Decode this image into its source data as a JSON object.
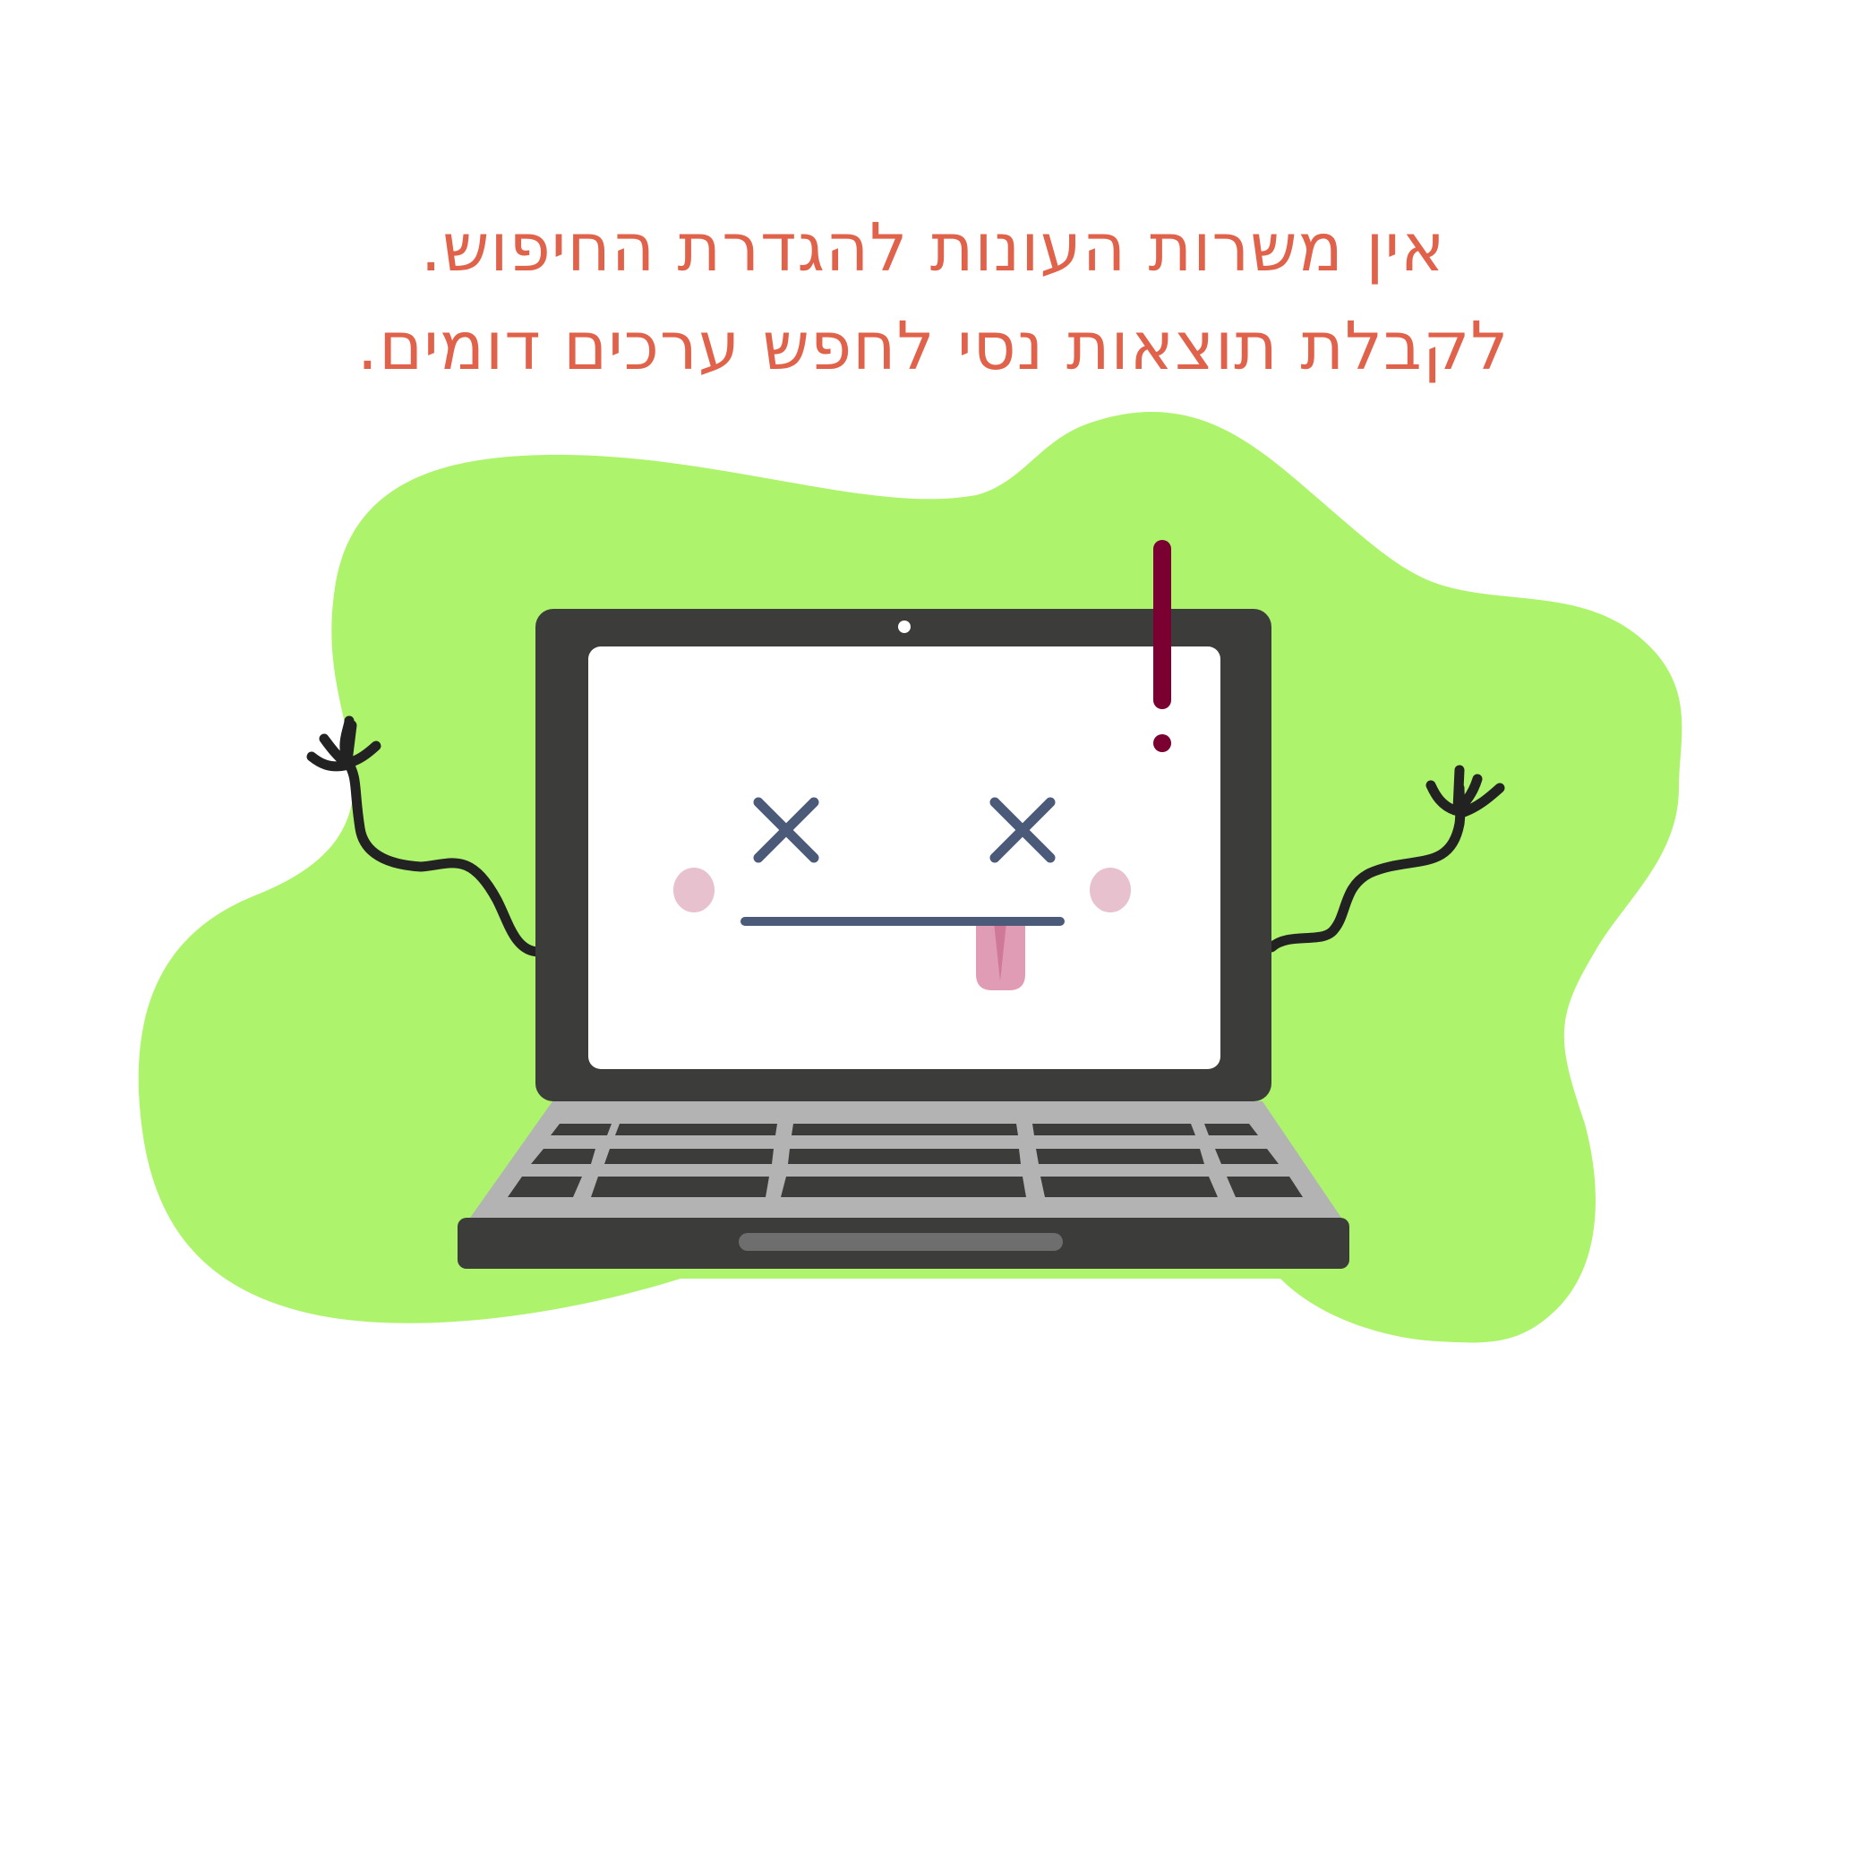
{
  "empty_state": {
    "line1": "אין משרות העונות להגדרת החיפוש.",
    "line2": "לקבלת תוצאות נסי לחפש ערכים דומים."
  },
  "illustration": {
    "subject": "sad-laptop",
    "blob_color": "#adf46c",
    "laptop_body_color": "#3c3c3a",
    "keyboard_color": "#b3b3b3",
    "exclamation_color": "#7a0031",
    "face_color": "#4a5a78",
    "cheek_color": "#e8c1cf",
    "tongue_color": "#e09cb5"
  }
}
